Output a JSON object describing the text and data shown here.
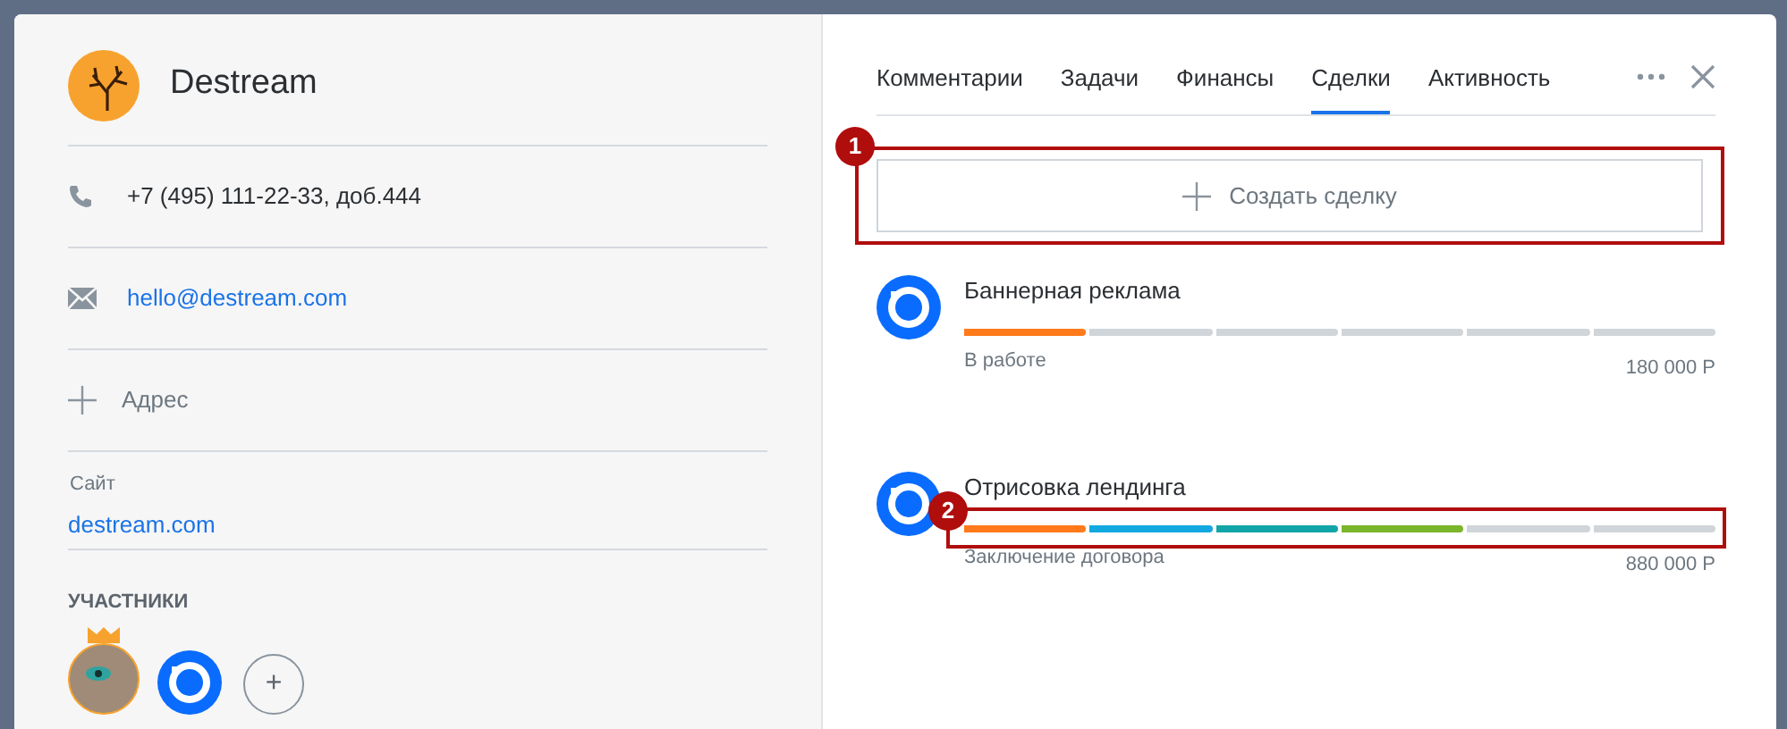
{
  "contact": {
    "name": "Destream",
    "phone": "+7 (495) 111-22-33, доб.444",
    "email": "hello@destream.com",
    "address_label": "Адрес",
    "site_label": "Сайт",
    "site": "destream.com",
    "participants_title": "УЧАСТНИКИ",
    "add_symbol": "+"
  },
  "tabs": [
    {
      "label": "Комментарии",
      "selected": false
    },
    {
      "label": "Задачи",
      "selected": false
    },
    {
      "label": "Финансы",
      "selected": false
    },
    {
      "label": "Сделки",
      "selected": true
    },
    {
      "label": "Активность",
      "selected": false
    }
  ],
  "create_deal": {
    "label": "Создать сделку",
    "marker": "1"
  },
  "deals": [
    {
      "title": "Баннерная реклама",
      "status": "В работе",
      "amount": "180 000 Р",
      "stages": [
        {
          "color": "#ff7a1a"
        },
        {
          "color": "#d0d5da"
        },
        {
          "color": "#d0d5da"
        },
        {
          "color": "#d0d5da"
        },
        {
          "color": "#d0d5da"
        },
        {
          "color": "#d0d5da"
        }
      ]
    },
    {
      "title": "Отрисовка лендинга",
      "status": "Заключение договора",
      "amount": "880 000 Р",
      "marker": "2",
      "stages": [
        {
          "color": "#ff7a1a"
        },
        {
          "color": "#13a9e0"
        },
        {
          "color": "#12a5a8"
        },
        {
          "color": "#7ab52a"
        },
        {
          "color": "#d0d5da"
        },
        {
          "color": "#d0d5da"
        }
      ]
    }
  ]
}
